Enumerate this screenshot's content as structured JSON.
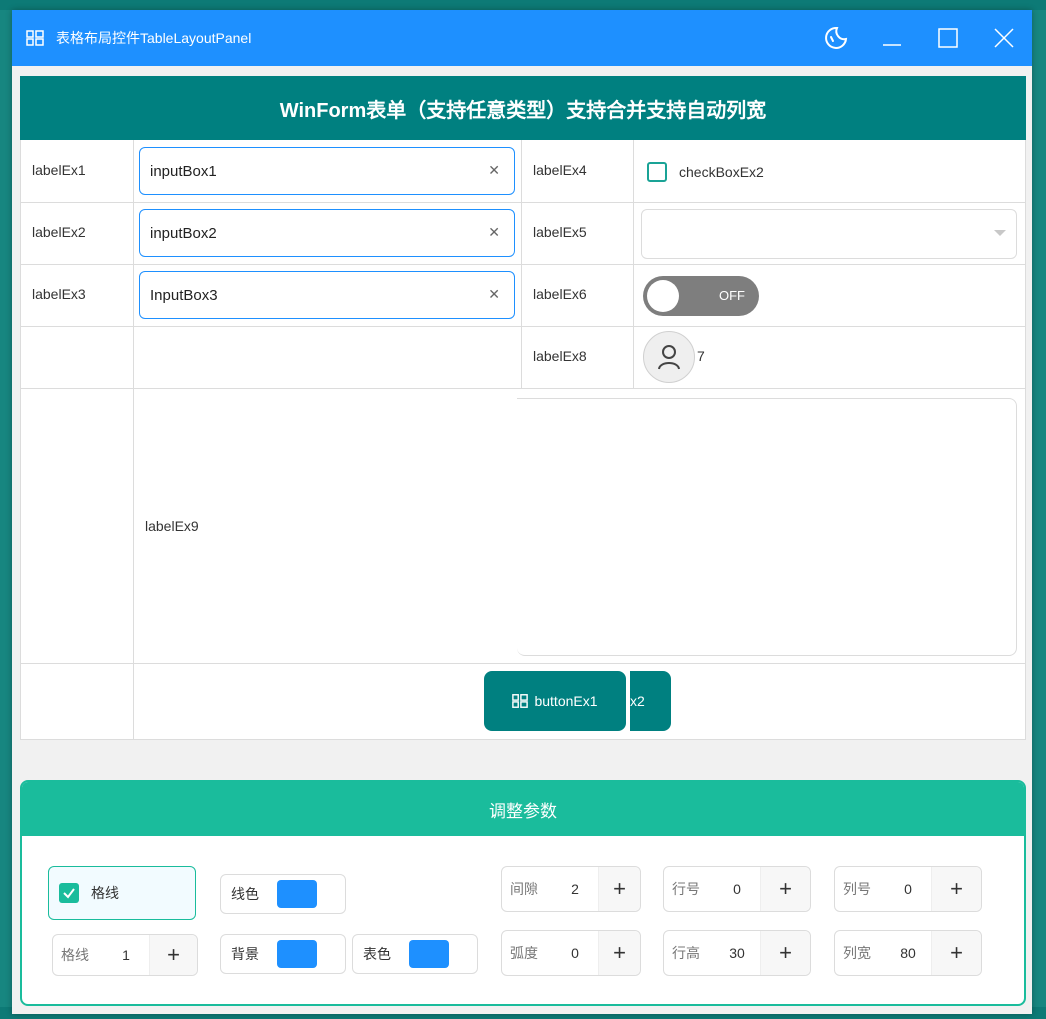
{
  "window": {
    "title": "表格布局控件TableLayoutPanel",
    "accent": "#1e90ff"
  },
  "table": {
    "header": "WinForm表单（支持任意类型）支持合并支持自动列宽",
    "labels": {
      "l1": "labelEx1",
      "l2": "labelEx2",
      "l3": "labelEx3",
      "l4": "labelEx4",
      "l5": "labelEx5",
      "l6": "labelEx6",
      "l8": "labelEx8",
      "l9": "labelEx9"
    },
    "inputs": {
      "i1": "inputBox1",
      "i2": "inputBox2",
      "i3": "nputBox3",
      "i3_prefix": "I"
    },
    "checkbox_label": "checkBoxEx2",
    "switch_label": "OFF",
    "avatar_count": "7",
    "button1": "buttonEx1",
    "button2_partial": "x2",
    "header_color": "#008080"
  },
  "params": {
    "title": "调整参数",
    "gridline_toggle": "格线",
    "line_color": "线色",
    "background": "背景",
    "table_color": "表色",
    "gridline_width": {
      "name": "格线",
      "value": "1"
    },
    "gap": {
      "name": "间隙",
      "value": "2"
    },
    "radius": {
      "name": "弧度",
      "value": "0"
    },
    "row_no": {
      "name": "行号",
      "value": "0"
    },
    "row_height": {
      "name": "行高",
      "value": "30"
    },
    "col_no": {
      "name": "列号",
      "value": "0"
    },
    "col_width": {
      "name": "列宽",
      "value": "80"
    },
    "plus": "+",
    "accent": "#1abc9c"
  }
}
